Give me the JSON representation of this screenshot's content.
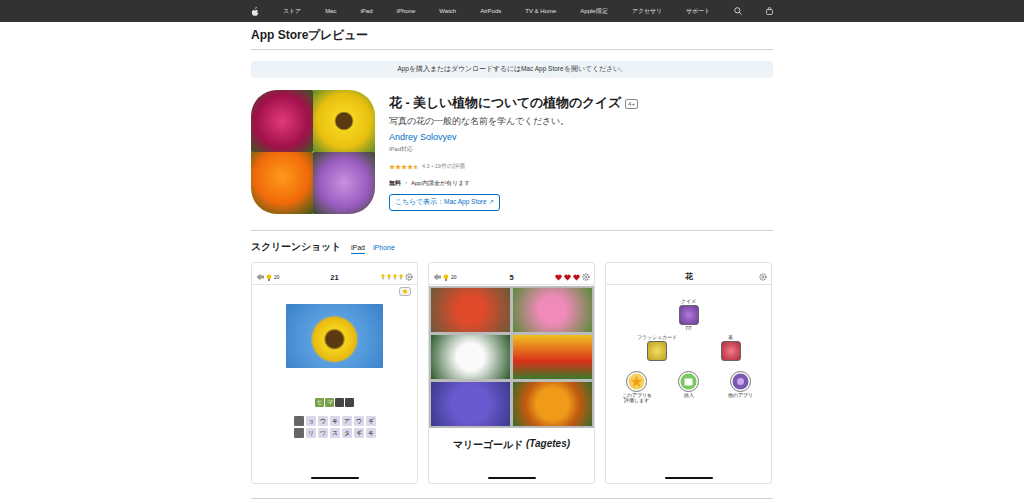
{
  "nav": {
    "items": [
      "ストア",
      "Mac",
      "iPad",
      "iPhone",
      "Watch",
      "AirPods",
      "TV & Home",
      "Apple限定",
      "アクセサリ",
      "サポート"
    ]
  },
  "header": {
    "title": "App Storeプレビュー"
  },
  "banner": {
    "text": "Appを購入またはダウンロードするにはMac App Storeを開いてください。"
  },
  "app": {
    "title": "花 - 美しい植物についての植物のクイズ",
    "age_rating": "4+",
    "subtitle": "写真の花の一般的な名前を学んでください。",
    "developer": "Andrey Solovyev",
    "compatibility": "iPad対応",
    "rating": {
      "stars": 4.5,
      "text": "4.3 • 19件の評価"
    },
    "price": "無料",
    "separator": "・",
    "in_app": "App内課金が有ります",
    "store_button": "こちらで表示：Mac App Store ↗"
  },
  "screenshots": {
    "title": "スクリーンショット",
    "tabs": [
      {
        "label": "iPad",
        "selected": true
      },
      {
        "label": "iPhone",
        "selected": false
      }
    ],
    "items": [
      {
        "kind": "letters",
        "hints": "20",
        "level": "21",
        "lamps": 4,
        "answer": [
          {
            "char": "ヒ",
            "filled": true
          },
          {
            "char": "マ",
            "filled": true
          },
          {
            "char": "",
            "filled": false
          },
          {
            "char": "",
            "filled": false
          }
        ],
        "keys": [
          [
            {
              "char": "",
              "used": true
            },
            {
              "char": "ョ",
              "used": false
            },
            {
              "char": "ウ",
              "used": false
            },
            {
              "char": "キ",
              "used": false
            },
            {
              "char": "ア",
              "used": false
            },
            {
              "char": "ウ",
              "used": false
            },
            {
              "char": "ギ",
              "used": false
            }
          ],
          [
            {
              "char": "",
              "used": true
            },
            {
              "char": "リ",
              "used": false
            },
            {
              "char": "ワ",
              "used": false
            },
            {
              "char": "ス",
              "used": false
            },
            {
              "char": "タ",
              "used": false
            },
            {
              "char": "ギ",
              "used": false
            },
            {
              "char": "キ",
              "used": false
            }
          ]
        ]
      },
      {
        "kind": "grid",
        "hints": "20",
        "level": "5",
        "lives": 3,
        "answer": "マリーゴールド",
        "latin": "(Tagetes)"
      },
      {
        "kind": "menu",
        "title": "花",
        "quiz": {
          "label": "クイズ",
          "progress": "7/7"
        },
        "flashcards": {
          "label": "フラッシュカード"
        },
        "table": {
          "label": "表"
        },
        "actions": [
          {
            "label": "このアプリを評価します"
          },
          {
            "label": "購入"
          },
          {
            "label": "他のアプリ"
          }
        ]
      }
    ]
  }
}
